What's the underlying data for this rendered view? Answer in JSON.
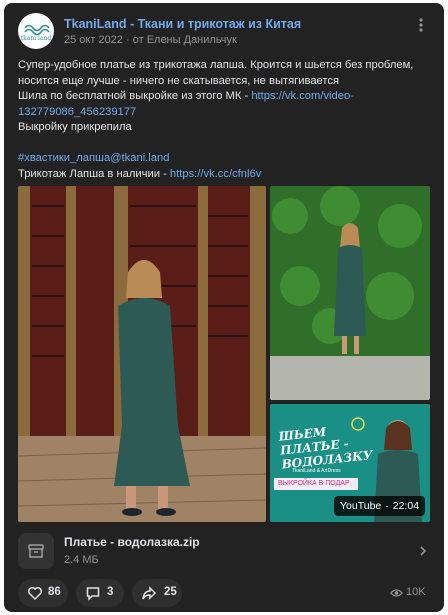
{
  "post": {
    "author": "TkaniLand - Ткани и трикотаж из Китая",
    "avatar_text": "tkani.land",
    "date": "25 окт 2022",
    "from": "от Елены Данильчук",
    "text": {
      "line1": "Супер-удобное платье из трикотажа лапша. Кроится и шьется без проблем,",
      "line2": "носится еще лучше - ничего не скатывается, не вытягивается",
      "line3_text": "Шила по бесплатной выкройке из этого МК - ",
      "line3_link": "https://vk.com/video-",
      "line4_link": "132779086_456239177",
      "line5": "Выкройку прикрепила",
      "hashtag": "#хвастики_лапша@tkani.land",
      "line7_text": "Трикотаж Лапша в наличии - ",
      "line7_link": "https://vk.cc/cfnl6v"
    }
  },
  "video": {
    "title": "ШЬЕМ ПЛАТЬЕ - ВОДОЛАЗКУ",
    "subtitle": "TkaniLand & ArtDress",
    "strip": "ВЫКРОЙКА В ПОДАР",
    "source": "YouTube",
    "duration": "22:04"
  },
  "attachment": {
    "name": "Платье - водолазка.zip",
    "size": "2.4 МБ"
  },
  "actions": {
    "likes": "86",
    "comments": "3",
    "shares": "25",
    "views": "10K"
  },
  "colors": {
    "card_bg": "#222222",
    "link": "#71aaeb",
    "text": "#e1e3e6",
    "muted": "#939393"
  },
  "icons": {
    "more": "more-vertical-icon",
    "file": "archive-icon",
    "chevron": "chevron-right-icon",
    "like": "heart-icon",
    "comment": "comment-icon",
    "share": "share-icon",
    "views": "eye-icon"
  }
}
